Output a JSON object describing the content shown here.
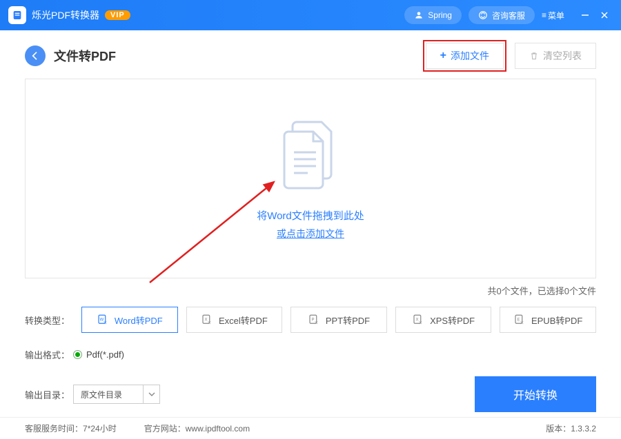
{
  "titlebar": {
    "app_name": "烁光PDF转换器",
    "vip_label": "VIP",
    "user_name": "Spring",
    "support_label": "咨询客服",
    "menu_label": "菜单"
  },
  "header": {
    "page_title": "文件转PDF",
    "add_file_label": "添加文件",
    "clear_label": "清空列表"
  },
  "dropzone": {
    "line1": "将Word文件拖拽到此处",
    "line2": "或点击添加文件"
  },
  "status": {
    "text": "共0个文件，已选择0个文件"
  },
  "type_row": {
    "label": "转换类型：",
    "tabs": [
      {
        "label": "Word转PDF",
        "code": "W",
        "active": true
      },
      {
        "label": "Excel转PDF",
        "code": "X",
        "active": false
      },
      {
        "label": "PPT转PDF",
        "code": "P",
        "active": false
      },
      {
        "label": "XPS转PDF",
        "code": "X",
        "active": false
      },
      {
        "label": "EPUB转PDF",
        "code": "E",
        "active": false
      }
    ]
  },
  "format_row": {
    "label": "输出格式：",
    "option": "Pdf(*.pdf)"
  },
  "dir_row": {
    "label": "输出目录：",
    "value": "原文件目录",
    "start_label": "开始转换"
  },
  "footer": {
    "service_label": "客服服务时间：",
    "service_value": "7*24小时",
    "site_label": "官方网站：",
    "site_value": "www.ipdftool.com",
    "version_label": "版本：",
    "version_value": "1.3.3.2"
  }
}
